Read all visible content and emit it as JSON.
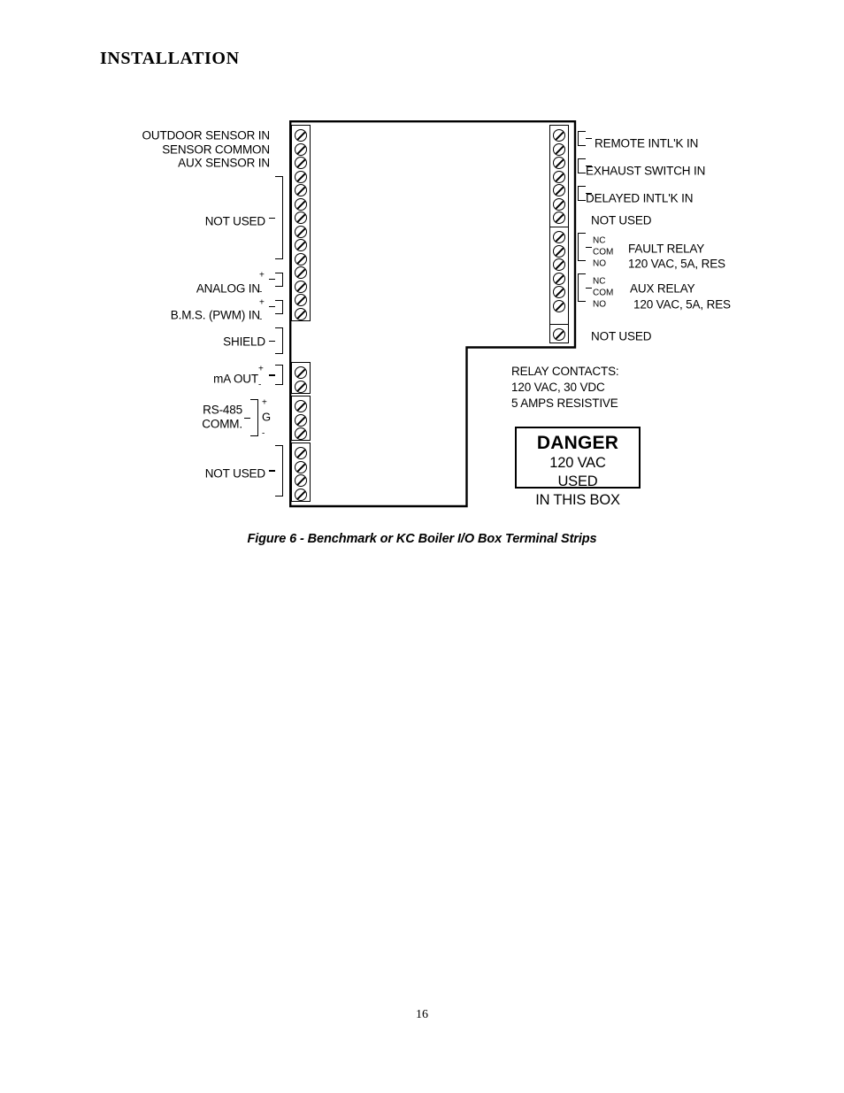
{
  "document": {
    "section_title": "INSTALLATION",
    "page_number": "16",
    "figure_caption": "Figure 6 - Benchmark or KC Boiler I/O Box Terminal Strips"
  },
  "diagram": {
    "left_strip": {
      "labels": [
        {
          "text": "OUTDOOR SENSOR IN"
        },
        {
          "text": "SENSOR COMMON"
        },
        {
          "text": "AUX SENSOR IN"
        },
        {
          "text": "NOT USED"
        },
        {
          "text": "ANALOG IN"
        },
        {
          "text": "B.M.S. (PWM) IN"
        },
        {
          "text": "SHIELD"
        },
        {
          "text": "mA OUT"
        },
        {
          "text": "RS-485"
        },
        {
          "text": "COMM."
        },
        {
          "text": "NOT USED"
        }
      ],
      "polarity": {
        "plus": "+",
        "minus": "-",
        "ground": "G"
      }
    },
    "right_strip": {
      "labels": [
        {
          "text": "REMOTE INTL'K IN"
        },
        {
          "text": "EXHAUST SWITCH IN"
        },
        {
          "text": "DELAYED INTL'K IN"
        },
        {
          "text": "NOT USED"
        },
        {
          "text": "FAULT RELAY"
        },
        {
          "text": "120 VAC, 5A, RES"
        },
        {
          "text": "AUX RELAY"
        },
        {
          "text": "120 VAC, 5A, RES"
        },
        {
          "text": "NOT USED"
        }
      ],
      "contact_marks": [
        "NC",
        "COM",
        "NO"
      ]
    },
    "relay_note": {
      "line1": "RELAY CONTACTS:",
      "line2": "120 VAC, 30 VDC",
      "line3": "5 AMPS RESISTIVE"
    },
    "danger_label": {
      "title": "DANGER",
      "line1": "120 VAC USED",
      "line2": "IN THIS BOX"
    }
  }
}
